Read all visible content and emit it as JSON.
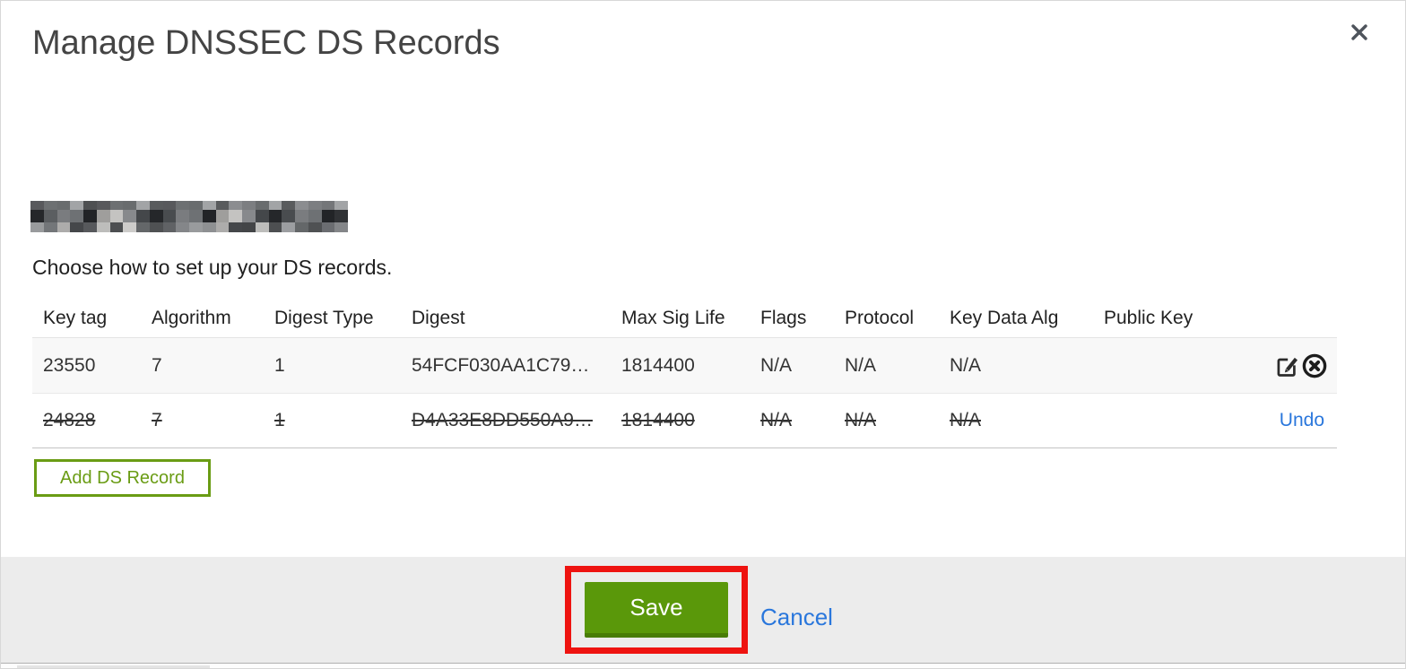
{
  "modal": {
    "title": "Manage DNSSEC DS Records",
    "intro": "Choose how to set up your DS records.",
    "domain_redacted": true
  },
  "table": {
    "columns": [
      "Key tag",
      "Algorithm",
      "Digest Type",
      "Digest",
      "Max Sig Life",
      "Flags",
      "Protocol",
      "Key Data Alg",
      "Public Key"
    ],
    "rows": [
      {
        "key_tag": "23550",
        "algorithm": "7",
        "digest_type": "1",
        "digest": "54FCF030AA1C79…",
        "max_sig_life": "1814400",
        "flags": "N/A",
        "protocol": "N/A",
        "key_data_alg": "N/A",
        "public_key": "",
        "state": "active"
      },
      {
        "key_tag": "24828",
        "algorithm": "7",
        "digest_type": "1",
        "digest": "D4A33E8DD550A9…",
        "max_sig_life": "1814400",
        "flags": "N/A",
        "protocol": "N/A",
        "key_data_alg": "N/A",
        "public_key": "",
        "state": "pending-delete",
        "undo_label": "Undo"
      }
    ]
  },
  "buttons": {
    "add_ds_record": "Add DS Record",
    "save": "Save",
    "cancel": "Cancel"
  },
  "icons": {
    "close": "x-mark",
    "edit": "pencil-in-square",
    "delete": "x-in-circle"
  },
  "colors": {
    "green": "#5a980a",
    "green_dark": "#487c06",
    "green_outline": "#6a9c14",
    "link_blue": "#2a77dc",
    "annotation_red": "#ee1310",
    "footer_bg": "#ececec",
    "row_alt_bg": "#f8f8f8"
  }
}
